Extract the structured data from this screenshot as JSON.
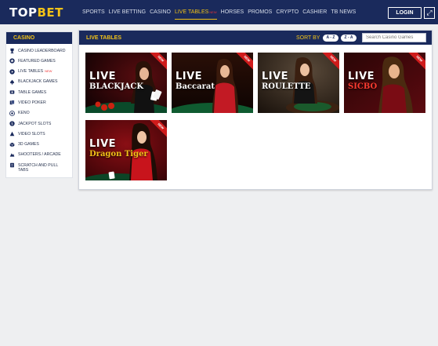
{
  "brand": {
    "part1": "TOP",
    "part2": "BET"
  },
  "nav": {
    "items": [
      {
        "label": "SPORTS"
      },
      {
        "label": "LIVE BETTING"
      },
      {
        "label": "CASINO"
      },
      {
        "label": "LIVE TABLES",
        "badge": "NEW"
      },
      {
        "label": "HORSES"
      },
      {
        "label": "PROMOS"
      },
      {
        "label": "CRYPTO"
      },
      {
        "label": "CASHIER"
      },
      {
        "label": "TB NEWS"
      }
    ],
    "login_label": "LOGIN",
    "expand_icon": "⤢"
  },
  "sidebar": {
    "title": "CASINO",
    "items": [
      {
        "label": "CASINO LEADERBOARD",
        "icon": "trophy"
      },
      {
        "label": "FEATURED GAMES",
        "icon": "star"
      },
      {
        "label": "LIVE TABLES",
        "badge": "NEW",
        "icon": "live"
      },
      {
        "label": "BLACKJACK GAMES",
        "icon": "spade"
      },
      {
        "label": "TABLE GAMES",
        "icon": "table"
      },
      {
        "label": "VIDEO POKER",
        "icon": "cards"
      },
      {
        "label": "KENO",
        "icon": "keno"
      },
      {
        "label": "JACKPOT SLOTS",
        "icon": "jackpot"
      },
      {
        "label": "VIDEO SLOTS",
        "icon": "slots"
      },
      {
        "label": "3D GAMES",
        "icon": "cube"
      },
      {
        "label": "SHOOTERS / ARCADE",
        "icon": "arcade"
      },
      {
        "label": "SCRATCH AND PULL TABS",
        "icon": "scratch"
      }
    ]
  },
  "main": {
    "title": "LIVE TABLES",
    "sort_label": "SORT BY",
    "sort_az": "A - Z",
    "sort_za": "Z - A",
    "search_placeholder": "Search Casino Games",
    "ribbon": "NEW",
    "games": [
      {
        "live": "LIVE",
        "name": "BLACKJACK",
        "theme": "blackjack"
      },
      {
        "live": "LIVE",
        "name": "Baccarat",
        "theme": "baccarat"
      },
      {
        "live": "LIVE",
        "name": "ROULETTE",
        "theme": "roulette"
      },
      {
        "live": "LIVE",
        "name": "SICBO",
        "theme": "sicbo"
      },
      {
        "live": "LIVE",
        "name": "Dragon Tiger",
        "theme": "dragontiger"
      }
    ]
  },
  "colors": {
    "navy": "#1a2a5c",
    "gold": "#f2c218",
    "page_bg": "#eeeff1",
    "ribbon": "#cf1b1b"
  }
}
